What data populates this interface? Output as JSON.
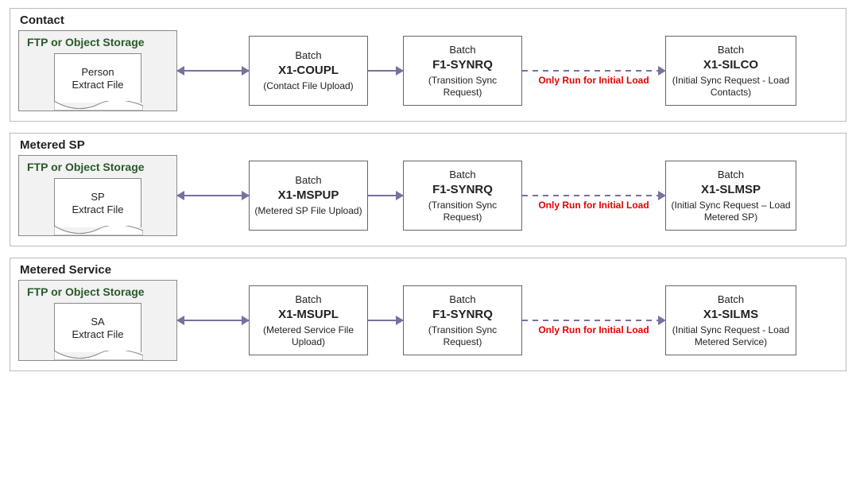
{
  "sections": [
    {
      "title": "Contact",
      "storage_title": "FTP or Object Storage",
      "file_line1": "Person",
      "file_line2": "Extract File",
      "step1": {
        "label": "Batch",
        "code": "X1-COUPL",
        "desc": "(Contact File Upload)"
      },
      "step2": {
        "label": "Batch",
        "code": "F1-SYNRQ",
        "desc": "(Transition Sync Request)"
      },
      "gap_caption": "Only Run for Initial Load",
      "step3": {
        "label": "Batch",
        "code": "X1-SILCO",
        "desc": "(Initial Sync Request - Load Contacts)"
      }
    },
    {
      "title": "Metered SP",
      "storage_title": "FTP or Object Storage",
      "file_line1": "SP",
      "file_line2": "Extract File",
      "step1": {
        "label": "Batch",
        "code": "X1-MSPUP",
        "desc": "(Metered SP File Upload)"
      },
      "step2": {
        "label": "Batch",
        "code": "F1-SYNRQ",
        "desc": "(Transition Sync Request)"
      },
      "gap_caption": "Only Run for Initial Load",
      "step3": {
        "label": "Batch",
        "code": "X1-SLMSP",
        "desc": "(Initial Sync Request – Load Metered SP)"
      }
    },
    {
      "title": "Metered Service",
      "storage_title": "FTP or Object Storage",
      "file_line1": "SA",
      "file_line2": "Extract File",
      "step1": {
        "label": "Batch",
        "code": "X1-MSUPL",
        "desc": "(Metered Service File Upload)"
      },
      "step2": {
        "label": "Batch",
        "code": "F1-SYNRQ",
        "desc": "(Transition Sync Request)"
      },
      "gap_caption": "Only Run for Initial Load",
      "step3": {
        "label": "Batch",
        "code": "X1-SILMS",
        "desc": "(Initial Sync Request - Load Metered Service)"
      }
    }
  ]
}
